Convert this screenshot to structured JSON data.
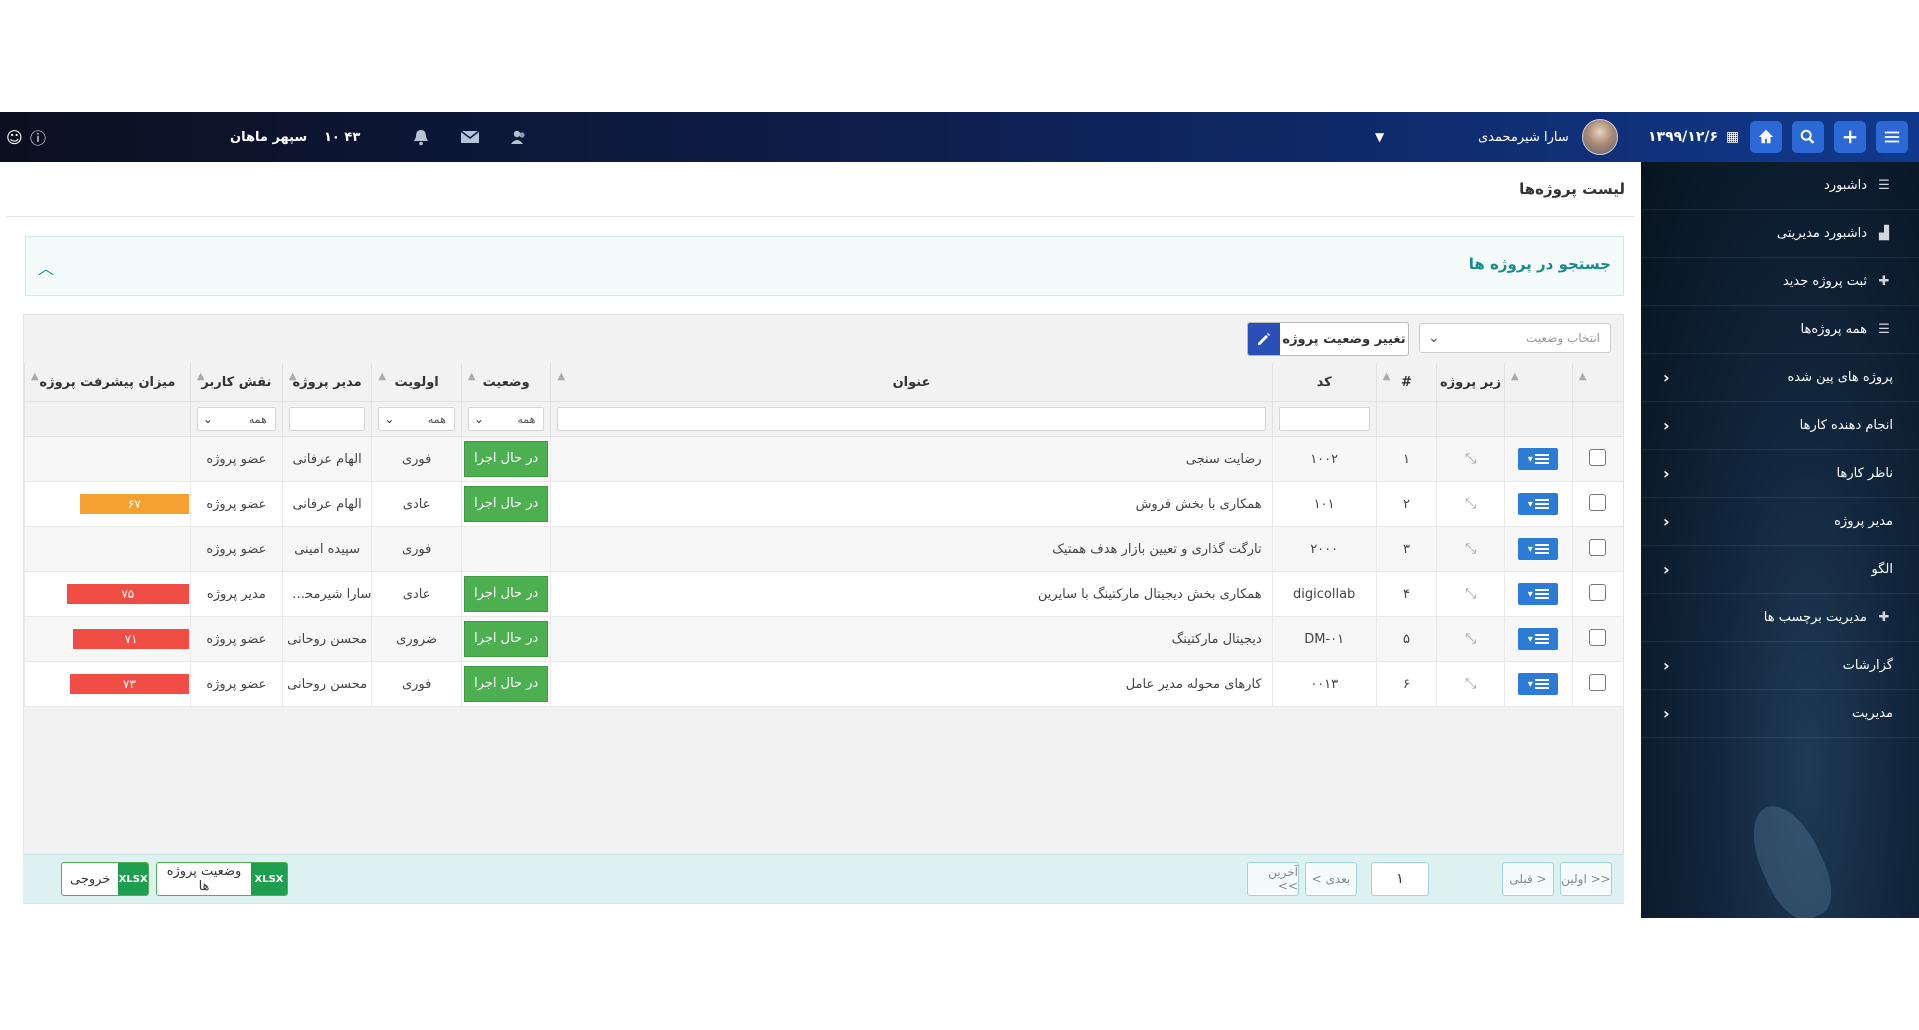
{
  "topbar": {
    "date": "۱۳۹۹/۱۲/۶",
    "user_name": "سارا شیرمحمدی",
    "org_name": "سپهر ماهان",
    "time": "۱۰ ۴۳"
  },
  "sidebar": {
    "items": [
      {
        "label": "داشبورد"
      },
      {
        "label": "داشبورد مدیریتی"
      },
      {
        "label": "ثبت پروژه جدید"
      },
      {
        "label": "همه پروژه‌ها"
      },
      {
        "label": "پروژه های پین شده"
      },
      {
        "label": "انجام دهنده کارها"
      },
      {
        "label": "ناظر کارها"
      },
      {
        "label": "مدیر پروژه"
      },
      {
        "label": "الگو"
      },
      {
        "label": "مدیریت برچسب ها"
      },
      {
        "label": "گزارشات"
      },
      {
        "label": "مدیریت"
      }
    ]
  },
  "page": {
    "title": "لیست پروژه‌ها",
    "search_title": "جستجو در پروژه ها"
  },
  "toolbar": {
    "status_placeholder": "انتخاب وضعیت",
    "change_status_label": "تغییر وضعیت پروژه"
  },
  "table": {
    "columns": {
      "subproject": "زیر پروژه",
      "number": "#",
      "code": "کد",
      "title": "عنوان",
      "status": "وضعیت",
      "priority": "اولویت",
      "manager": "مدیر پروژه",
      "role": "نقش کاربر",
      "progress": "میزان پیشرفت پروژه"
    },
    "filter_all": "همه",
    "rows": [
      {
        "num": "۱",
        "code": "۱۰۰۲",
        "title": "رضایت سنجی",
        "status": "در حال اجرا",
        "priority": "فوری",
        "manager": "الهام عرفانی",
        "role": "عضو پروژه",
        "progress": ""
      },
      {
        "num": "۲",
        "code": "۱۰۱",
        "title": "همکاری با بخش فروش",
        "status": "در حال اجرا",
        "priority": "عادی",
        "manager": "الهام عرفانی",
        "role": "عضو پروژه",
        "progress": "۶۷"
      },
      {
        "num": "۳",
        "code": "۲۰۰۰",
        "title": "تارگت گذاری و تعیین بازار هدف همتیک",
        "status": "",
        "priority": "فوری",
        "manager": "سپیده امینی",
        "role": "عضو پروژه",
        "progress": ""
      },
      {
        "num": "۴",
        "code": "digicollab",
        "title": "همکاری بخش دیجیتال مارکتینگ با سایرین",
        "status": "در حال اجرا",
        "priority": "عادی",
        "manager": "سارا شیرمحمدی",
        "role": "مدیر پروژه",
        "progress": "۷۵"
      },
      {
        "num": "۵",
        "code": "DM-۰۱",
        "title": "دیجیتال مارکتینگ",
        "status": "در حال اجرا",
        "priority": "ضروری",
        "manager": "محسن روحانی",
        "role": "عضو پروژه",
        "progress": "۷۱"
      },
      {
        "num": "۶",
        "code": "۰۰۱۳",
        "title": "کارهای محوله مدیر عامل",
        "status": "در حال اجرا",
        "priority": "فوری",
        "manager": "محسن روحانی",
        "role": "عضو پروژه",
        "progress": "۷۳"
      }
    ],
    "progress_values": [
      null,
      67,
      null,
      75,
      71,
      73
    ],
    "progress_colors": [
      "",
      "#f5a132",
      "",
      "#f04e45",
      "#f04e45",
      "#f04e45"
    ]
  },
  "pager": {
    "first": "<< اولین",
    "prev": "< قبلی",
    "page": "۱",
    "next": "بعدی >",
    "last": "آخرین >>"
  },
  "export": {
    "status_label": "وضعیت پروژه ها",
    "output_label": "خروجی",
    "xlsx": "XLSX"
  }
}
